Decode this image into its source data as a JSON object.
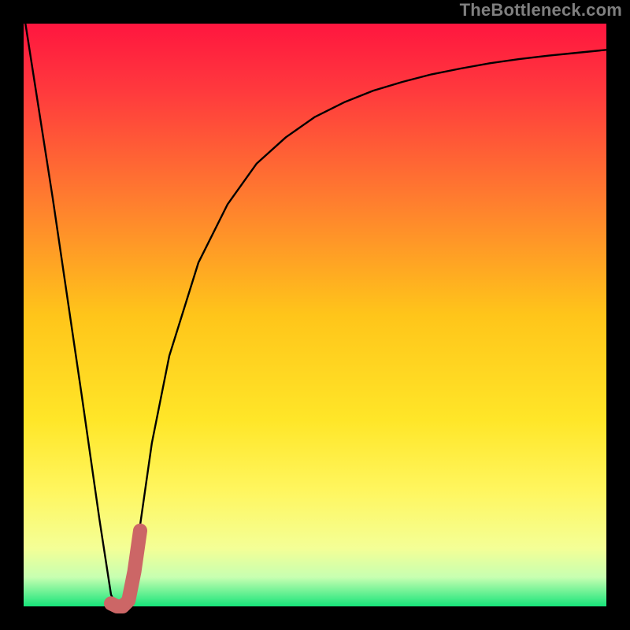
{
  "watermark": "TheBottleneck.com",
  "chart_data": {
    "type": "line",
    "title": "",
    "xlabel": "",
    "ylabel": "",
    "xlim": [
      0,
      1
    ],
    "ylim": [
      0,
      1
    ],
    "series": [
      {
        "name": "bottleneck-curve",
        "x": [
          0.0,
          0.05,
          0.1,
          0.13,
          0.15,
          0.16,
          0.17,
          0.18,
          0.19,
          0.2,
          0.22,
          0.25,
          0.3,
          0.35,
          0.4,
          0.45,
          0.5,
          0.55,
          0.6,
          0.65,
          0.7,
          0.75,
          0.8,
          0.85,
          0.9,
          0.95,
          1.0
        ],
        "y": [
          1.02,
          0.7,
          0.36,
          0.15,
          0.02,
          0.0,
          0.0,
          0.01,
          0.06,
          0.14,
          0.28,
          0.43,
          0.59,
          0.69,
          0.76,
          0.805,
          0.84,
          0.865,
          0.885,
          0.9,
          0.913,
          0.923,
          0.932,
          0.939,
          0.945,
          0.95,
          0.955
        ]
      }
    ],
    "highlight": {
      "name": "optimal-zone-marker",
      "color": "#cc6666",
      "x": [
        0.15,
        0.16,
        0.17,
        0.18,
        0.19,
        0.2
      ],
      "y": [
        0.005,
        0.0,
        0.0,
        0.01,
        0.06,
        0.13
      ]
    },
    "background": {
      "type": "vertical-gradient",
      "stops": [
        {
          "offset": 0.0,
          "color": "#ff163f"
        },
        {
          "offset": 0.12,
          "color": "#ff3b3d"
        },
        {
          "offset": 0.3,
          "color": "#ff7c2f"
        },
        {
          "offset": 0.5,
          "color": "#ffc51a"
        },
        {
          "offset": 0.68,
          "color": "#ffe628"
        },
        {
          "offset": 0.8,
          "color": "#fff65e"
        },
        {
          "offset": 0.9,
          "color": "#f4ff96"
        },
        {
          "offset": 0.95,
          "color": "#c7ffb1"
        },
        {
          "offset": 1.0,
          "color": "#17e47a"
        }
      ]
    },
    "frame": {
      "inner_x": 30,
      "inner_y": 30,
      "inner_w": 740,
      "inner_h": 740
    }
  }
}
